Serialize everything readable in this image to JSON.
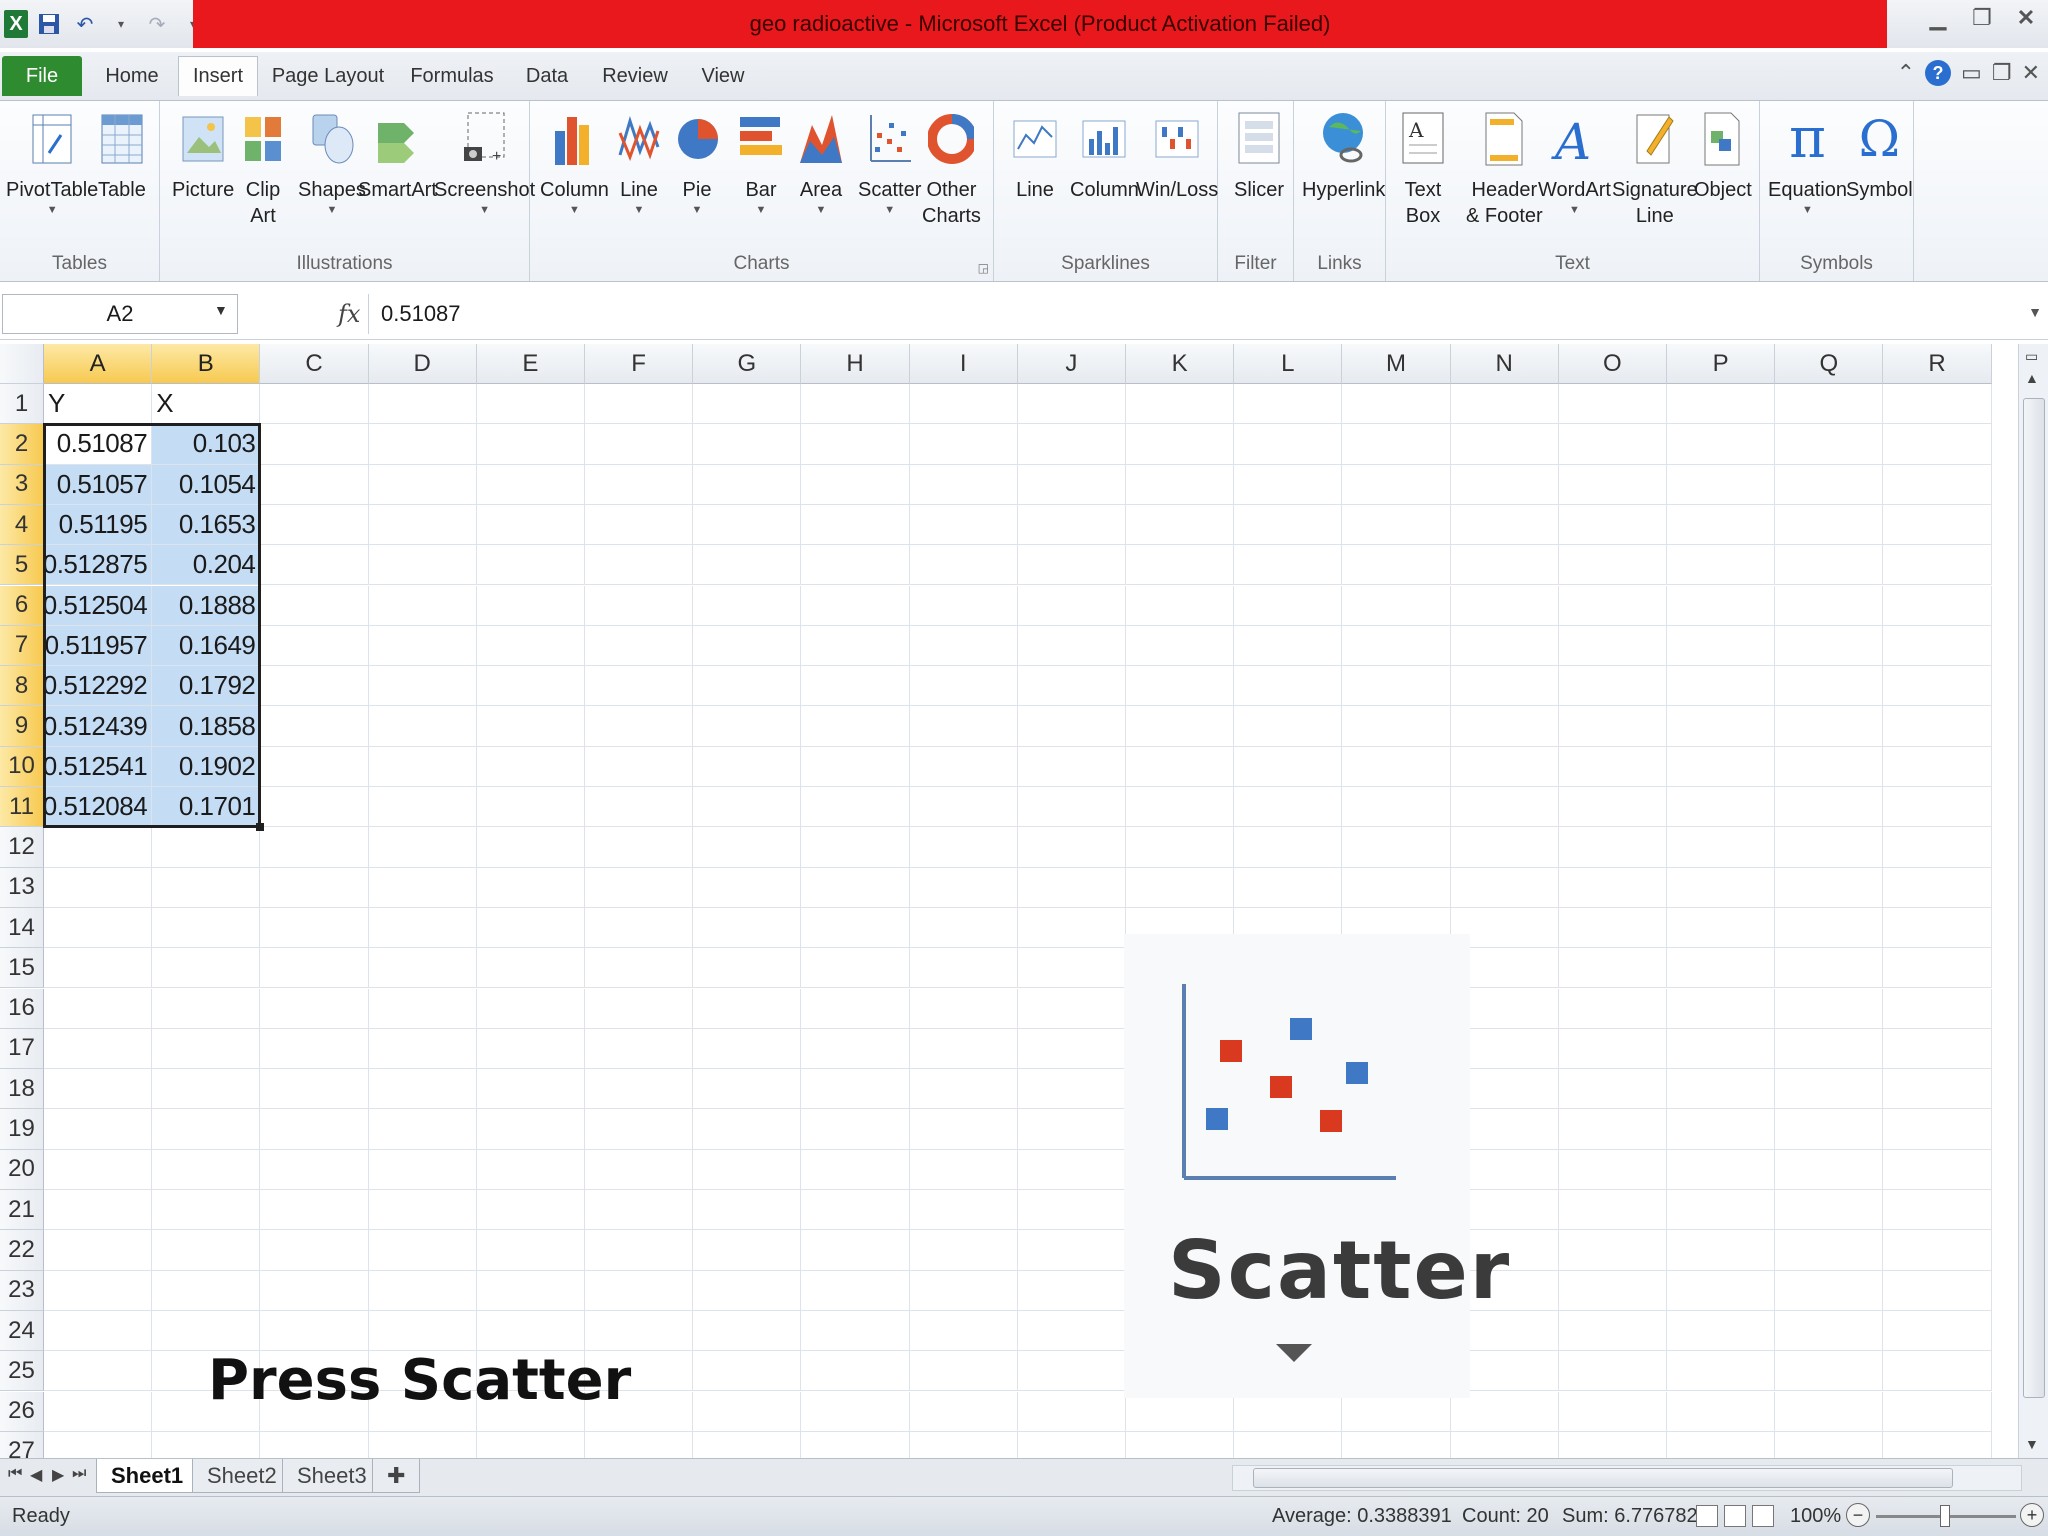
{
  "window": {
    "title": "geo radioactive  -  Microsoft Excel (Product Activation Failed)",
    "logo_letter": "X"
  },
  "tabs": [
    "File",
    "Home",
    "Insert",
    "Page Layout",
    "Formulas",
    "Data",
    "Review",
    "View"
  ],
  "active_tab": "Insert",
  "ribbon": {
    "tables": {
      "label": "Tables",
      "buttons": [
        "PivotTable",
        "Table"
      ]
    },
    "illustrations": {
      "label": "Illustrations",
      "buttons": [
        "Picture",
        "Clip\nArt",
        "Shapes",
        "SmartArt",
        "Screenshot"
      ]
    },
    "charts": {
      "label": "Charts",
      "buttons": [
        "Column",
        "Line",
        "Pie",
        "Bar",
        "Area",
        "Scatter",
        "Other\nCharts"
      ]
    },
    "sparklines": {
      "label": "Sparklines",
      "buttons": [
        "Line",
        "Column",
        "Win/Loss"
      ]
    },
    "filter": {
      "label": "Filter",
      "buttons": [
        "Slicer"
      ]
    },
    "links": {
      "label": "Links",
      "buttons": [
        "Hyperlink"
      ]
    },
    "text": {
      "label": "Text",
      "buttons": [
        "Text\nBox",
        "Header\n& Footer",
        "WordArt",
        "Signature\nLine",
        "Object"
      ]
    },
    "symbols": {
      "label": "Symbols",
      "buttons": [
        "Equation",
        "Symbol"
      ]
    }
  },
  "formula_bar": {
    "name_box": "A2",
    "fx_label": "fx",
    "value": "0.51087"
  },
  "sheet": {
    "columns": [
      "A",
      "B",
      "C",
      "D",
      "E",
      "F",
      "G",
      "H",
      "I",
      "J",
      "K",
      "L",
      "M",
      "N",
      "O",
      "P",
      "Q",
      "R"
    ],
    "rows": [
      "1",
      "2",
      "3",
      "4",
      "5",
      "6",
      "7",
      "8",
      "9",
      "10",
      "11",
      "12",
      "13",
      "14",
      "15",
      "16",
      "17",
      "18",
      "19",
      "20",
      "21",
      "22",
      "23",
      "24",
      "25",
      "26",
      "27"
    ],
    "header_row": [
      "Y",
      "X"
    ],
    "data": [
      [
        "0.51087",
        "0.103"
      ],
      [
        "0.51057",
        "0.1054"
      ],
      [
        "0.51195",
        "0.1653"
      ],
      [
        "0.512875",
        "0.204"
      ],
      [
        "0.512504",
        "0.1888"
      ],
      [
        "0.511957",
        "0.1649"
      ],
      [
        "0.512292",
        "0.1792"
      ],
      [
        "0.512439",
        "0.1858"
      ],
      [
        "0.512541",
        "0.1902"
      ],
      [
        "0.512084",
        "0.1701"
      ]
    ]
  },
  "overlay_instruction": "Press Scatter",
  "zoom_callout": {
    "label": "Scatter"
  },
  "sheet_tabs": [
    "Sheet1",
    "Sheet2",
    "Sheet3"
  ],
  "active_sheet": "Sheet1",
  "status": {
    "ready": "Ready",
    "average": "Average: 0.3388391",
    "count": "Count: 20",
    "sum": "Sum: 6.776782",
    "zoom": "100%"
  },
  "colors": {
    "title_bar_red": "#e8181c",
    "file_tab_green": "#2e8b2f",
    "selection_highlight": "#c5dcf5",
    "header_selected": "#f7c950"
  }
}
